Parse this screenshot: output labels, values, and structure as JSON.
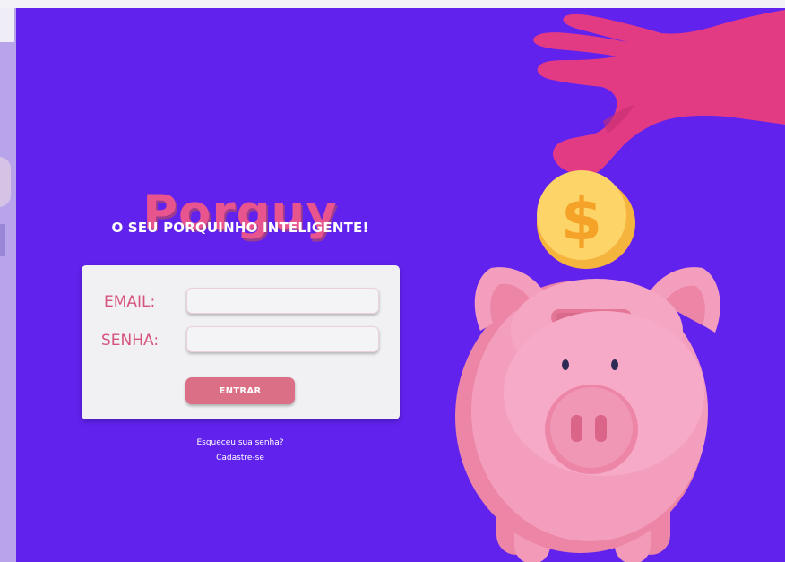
{
  "brand": {
    "title": "Porguy",
    "tagline": "O SEU PORQUINHO INTELIGENTE!"
  },
  "login": {
    "email_label": "EMAIL:",
    "email_value": "",
    "password_label": "SENHA:",
    "password_value": "",
    "submit_label": "ENTRAR"
  },
  "links": {
    "forgot_password": "Esqueceu sua senha?",
    "sign_up": "Cadastre-se"
  },
  "illustration": {
    "coin_symbol": "$",
    "icons": [
      "hand-icon",
      "coin-icon",
      "piggy-bank-icon"
    ]
  },
  "colors": {
    "background": "#6122ee",
    "brand_pink": "#e7548e",
    "button": "#da6f86",
    "hand": "#e33a84",
    "coin": "#fdd468",
    "pig": "#f49ebe"
  }
}
